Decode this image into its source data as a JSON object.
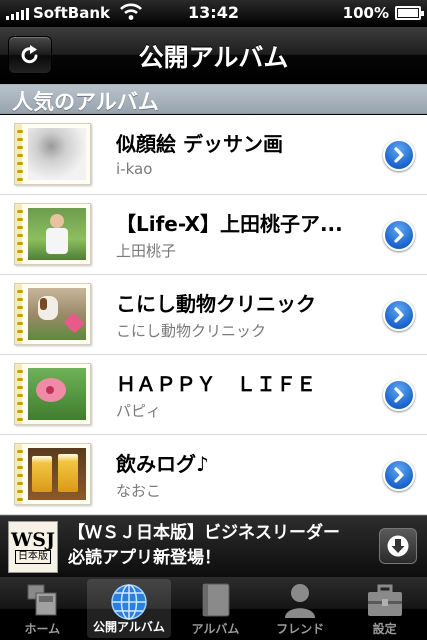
{
  "status_bar": {
    "carrier": "SoftBank",
    "time": "13:42",
    "battery": "100%"
  },
  "nav": {
    "title": "公開アルバム",
    "refresh_icon": "refresh-icon"
  },
  "section": {
    "header": "人気のアルバム"
  },
  "albums": [
    {
      "title": "似顔絵 デッサン画",
      "author": "i-kao"
    },
    {
      "title": "【Life-X】上田桃子ア...",
      "author": "上田桃子"
    },
    {
      "title": "こにし動物クリニック",
      "author": "こにし動物クリニック"
    },
    {
      "title": "ＨＡＰＰＹ　ＬＩＦＥ",
      "author": "パピィ"
    },
    {
      "title": "飲みログ♪",
      "author": "なおこ"
    }
  ],
  "ad": {
    "logo_text": "WSJ",
    "logo_sub": "日本版",
    "line1": "【ＷＳＪ日本版】ビジネスリーダー",
    "line2": "必読アプリ新登場！"
  },
  "tabs": [
    {
      "label": "ホーム",
      "icon": "home-icon",
      "active": false
    },
    {
      "label": "公開アルバム",
      "icon": "globe-icon",
      "active": true
    },
    {
      "label": "アルバム",
      "icon": "album-book-icon",
      "active": false
    },
    {
      "label": "フレンド",
      "icon": "person-icon",
      "active": false
    },
    {
      "label": "設定",
      "icon": "toolbox-icon",
      "active": false
    }
  ],
  "colors": {
    "disclosure_blue": "#1e68d0",
    "section_header": "#a9b4be",
    "album_ring": "#c8a000"
  }
}
